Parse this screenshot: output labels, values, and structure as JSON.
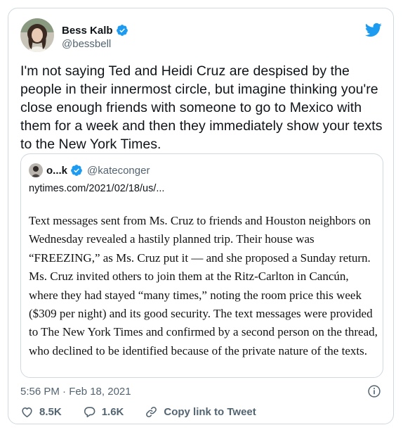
{
  "author": {
    "name": "Bess Kalb",
    "handle": "@bessbell"
  },
  "tweet": {
    "text": "I'm not saying Ted and Heidi Cruz are despised by the people in their innermost circle, but imagine thinking you're close enough friends with someone to go to Mexico with them for a week and then they immediately show your texts to the New York Times."
  },
  "quote": {
    "name": "o...k",
    "handle": "@kateconger",
    "link": "nytimes.com/2021/02/18/us/...",
    "body": "Text messages sent from Ms. Cruz to friends and Houston neighbors on Wednesday revealed a hastily planned trip. Their house was “FREEZING,” as Ms. Cruz put it — and she proposed a Sunday return. Ms. Cruz invited others to join them at the Ritz-Carlton in Cancún, where they had stayed “many times,” noting the room price this week ($309 per night) and its good security. The text messages were provided to The New York Times and confirmed by a second person on the thread, who declined to be identified because of the private nature of the texts."
  },
  "meta": {
    "timestamp": "5:56 PM · Feb 18, 2021"
  },
  "actions": {
    "likes": "8.5K",
    "replies": "1.6K",
    "copy_link": "Copy link to Tweet"
  },
  "icons": {
    "brand": "twitter-bird-icon",
    "verified": "verified-badge-icon",
    "info": "info-icon",
    "like": "heart-icon",
    "reply": "reply-icon",
    "link": "link-icon"
  },
  "colors": {
    "twitter_blue": "#1d9bf0",
    "secondary_text": "#536471",
    "border": "#cfd9de"
  }
}
